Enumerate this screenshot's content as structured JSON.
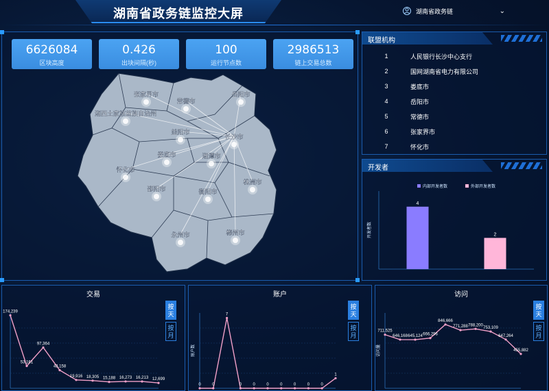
{
  "header": {
    "title": "湖南省政务链监控大屏",
    "org_select": "湖南省政务链"
  },
  "stats": [
    {
      "value": "6626084",
      "label": "区块高度"
    },
    {
      "value": "0.426",
      "label": "出块间隔(秒)"
    },
    {
      "value": "100",
      "label": "运行节点数"
    },
    {
      "value": "2986513",
      "label": "链上交易总数"
    }
  ],
  "map": {
    "cities": [
      "张家界市",
      "常德市",
      "岳阳市",
      "湘西土家族苗族自治州",
      "益阳市",
      "长沙市",
      "娄底市",
      "湘潭市",
      "怀化市",
      "株洲市",
      "邵阳市",
      "衡阳市",
      "永州市",
      "郴州市"
    ]
  },
  "alliance": {
    "title": "联盟机构",
    "rows": [
      {
        "index": "1",
        "name": "人民银行长沙中心支行"
      },
      {
        "index": "2",
        "name": "国网湖南省电力有限公司"
      },
      {
        "index": "3",
        "name": "娄底市"
      },
      {
        "index": "4",
        "name": "岳阳市"
      },
      {
        "index": "5",
        "name": "常德市"
      },
      {
        "index": "6",
        "name": "张家界市"
      },
      {
        "index": "7",
        "name": "怀化市"
      }
    ]
  },
  "developers": {
    "title": "开发者"
  },
  "bottom": {
    "tx_title": "交易",
    "acct_title": "账户",
    "visit_title": "访问",
    "by_day": "按天",
    "by_month": "按月"
  },
  "chart_data": [
    {
      "type": "bar",
      "title": "",
      "ylabel": "开发者数",
      "categories": [
        ""
      ],
      "series": [
        {
          "name": "内部开发者数",
          "values": [
            4
          ],
          "color": "#8a7cff"
        },
        {
          "name": "外部开发者数",
          "values": [
            2
          ],
          "color": "#ffb6d9"
        }
      ],
      "ylim": [
        0,
        5
      ]
    },
    {
      "type": "line",
      "title": "交易",
      "values": [
        174239,
        53161,
        97364,
        43158,
        19916,
        18305,
        15188,
        16273,
        16213,
        12699
      ],
      "labels": [
        "174,239",
        "53,161",
        "97,364",
        "43,158",
        "19,916",
        "18,305",
        "15,188",
        "16,273",
        "16,213",
        "12,699"
      ],
      "ylim": [
        0,
        180000
      ],
      "color": "#f2a0c8"
    },
    {
      "type": "line",
      "title": "账户",
      "ylabel": "账户数",
      "values": [
        0,
        0,
        7,
        0,
        0,
        0,
        0,
        0,
        0,
        0,
        1
      ],
      "labels": [
        "0",
        "0",
        "7",
        "0",
        "0",
        "0",
        "0",
        "0",
        "0",
        "0",
        "1"
      ],
      "ylim": [
        0,
        7.5
      ],
      "color": "#f2a0c8"
    },
    {
      "type": "line",
      "title": "访问",
      "ylabel": "访问量",
      "values": [
        711525,
        646168,
        645124,
        666296,
        846666,
        771288,
        788200,
        753109,
        647264,
        455882
      ],
      "labels": [
        "711,525",
        "646,168",
        "645,124",
        "666,296",
        "846,666",
        "771,288",
        "788,200",
        "753,109",
        "647,264",
        "455,882"
      ],
      "ylim": [
        0,
        1000000
      ],
      "color": "#f2a0c8"
    }
  ]
}
